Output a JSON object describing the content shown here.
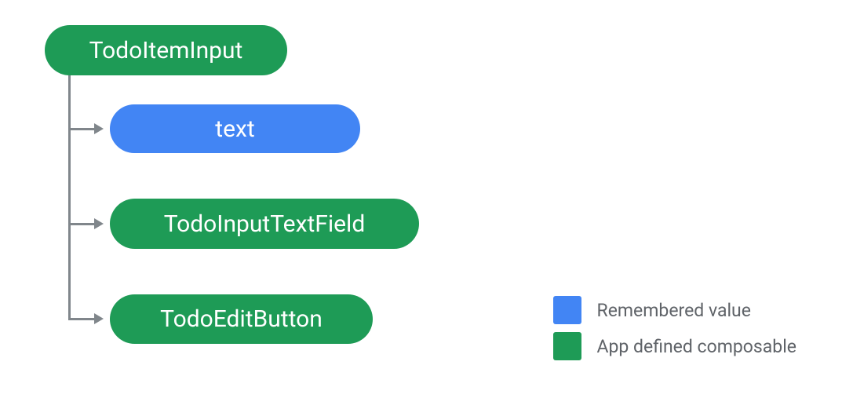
{
  "nodes": {
    "root": {
      "label": "TodoItemInput",
      "color": "green"
    },
    "child1": {
      "label": "text",
      "color": "blue"
    },
    "child2": {
      "label": "TodoInputTextField",
      "color": "green"
    },
    "child3": {
      "label": "TodoEditButton",
      "color": "green"
    }
  },
  "legend": {
    "items": [
      {
        "label": "Remembered value",
        "color": "blue"
      },
      {
        "label": "App defined composable",
        "color": "green"
      }
    ]
  },
  "colors": {
    "green": "#1e9b56",
    "blue": "#4285f4",
    "connector": "#80868b",
    "legendText": "#5f6368"
  }
}
